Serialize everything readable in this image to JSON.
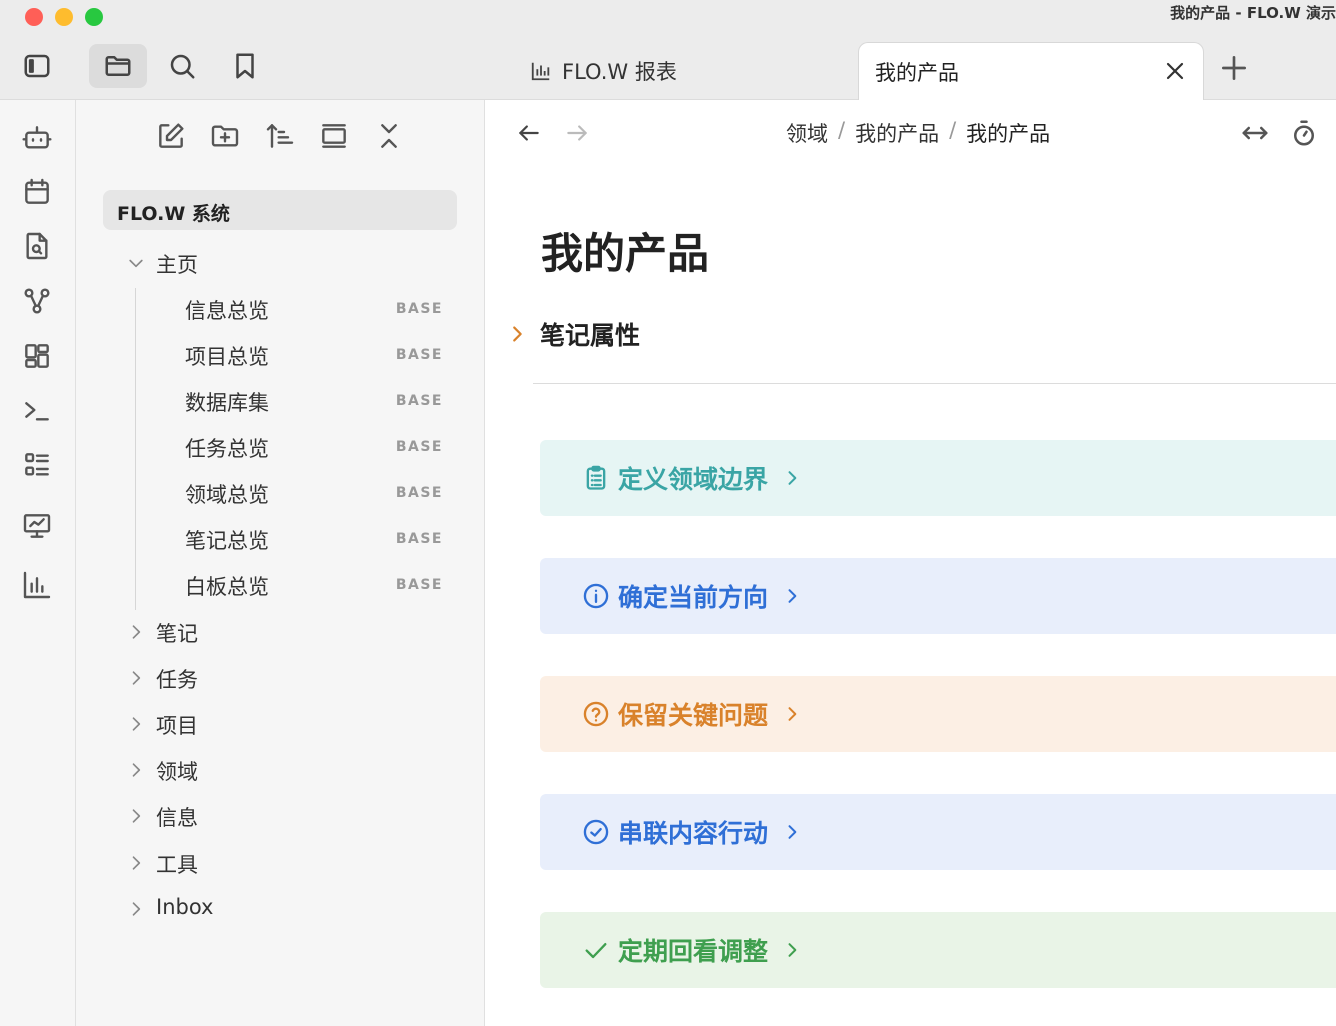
{
  "window": {
    "title": "我的产品 - FLO.W 演示"
  },
  "toolbar": {
    "icons": [
      "sidebar-toggle-icon",
      "folder-icon",
      "search-icon",
      "bookmark-icon"
    ]
  },
  "tabs": [
    {
      "label": "FLO.W 报表",
      "icon": "bar-chart-icon",
      "active": false
    },
    {
      "label": "我的产品",
      "active": true
    }
  ],
  "ribbon": {
    "icons": [
      "robot-icon",
      "calendar-icon",
      "file-search-icon",
      "graph-icon",
      "dashboard-icon",
      "terminal-icon",
      "list-icon",
      "presentation-icon",
      "bar-chart-icon"
    ]
  },
  "explorer": {
    "tools": [
      "new-note-icon",
      "new-folder-icon",
      "sort-icon",
      "collapse-view-icon",
      "collapse-all-icon"
    ],
    "vault_name": "FLO.W 系统",
    "home": {
      "label": "主页",
      "expanded": true,
      "children": [
        {
          "label": "信息总览",
          "tag": "BASE"
        },
        {
          "label": "项目总览",
          "tag": "BASE"
        },
        {
          "label": "数据库集",
          "tag": "BASE"
        },
        {
          "label": "任务总览",
          "tag": "BASE"
        },
        {
          "label": "领域总览",
          "tag": "BASE"
        },
        {
          "label": "笔记总览",
          "tag": "BASE"
        },
        {
          "label": "白板总览",
          "tag": "BASE"
        }
      ]
    },
    "folders": [
      {
        "label": "笔记"
      },
      {
        "label": "任务"
      },
      {
        "label": "项目"
      },
      {
        "label": "领域"
      },
      {
        "label": "信息"
      },
      {
        "label": "工具"
      },
      {
        "label": "Inbox"
      }
    ]
  },
  "main": {
    "breadcrumb": [
      "领域",
      "我的产品",
      "我的产品"
    ],
    "breadcrumb_sep": "/",
    "title": "我的产品",
    "properties_label": "笔记属性",
    "callouts": [
      {
        "title": "定义领域边界",
        "icon": "clipboard-list-icon",
        "color": "#3aa5a5",
        "bg": "#e6f5f4"
      },
      {
        "title": "确定当前方向",
        "icon": "info-circle-icon",
        "color": "#2f6fd6",
        "bg": "#e8eefb"
      },
      {
        "title": "保留关键问题",
        "icon": "question-circle-icon",
        "color": "#d9822b",
        "bg": "#fcefe4"
      },
      {
        "title": "串联内容行动",
        "icon": "check-circle-icon",
        "color": "#2f6fd6",
        "bg": "#e8eefb"
      },
      {
        "title": "定期回看调整",
        "icon": "check-icon",
        "color": "#3f9f4f",
        "bg": "#e9f4e7"
      }
    ]
  },
  "colors": {
    "accent_orange": "#d9822b"
  }
}
